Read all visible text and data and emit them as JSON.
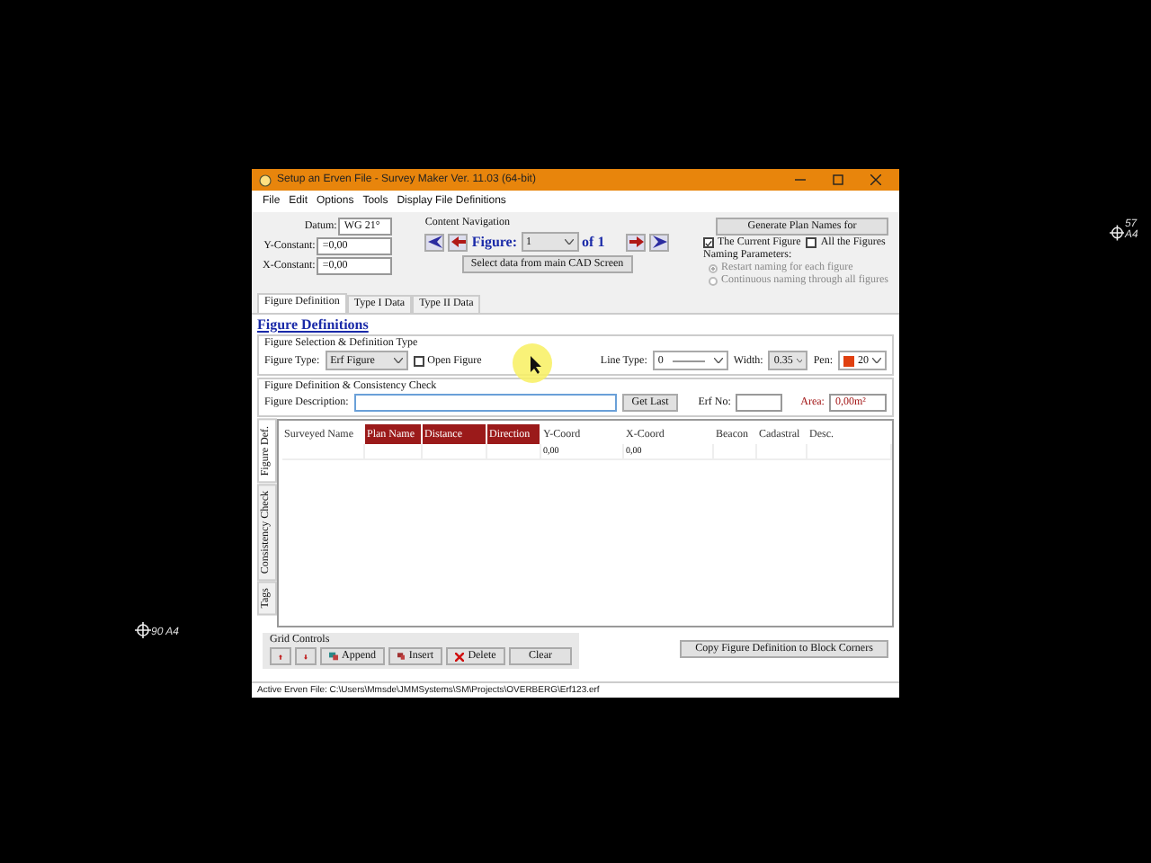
{
  "window": {
    "title": "Setup an Erven File - Survey Maker Ver. 11.03 (64-bit)"
  },
  "menu": [
    "File",
    "Edit",
    "Options",
    "Tools",
    "Display File Definitions"
  ],
  "coordinates": [
    {
      "label": "Datum:",
      "value": "WG 21°"
    },
    {
      "label": "Y-Constant:",
      "value": "=0,00"
    },
    {
      "label": "X-Constant:",
      "value": "=0,00"
    }
  ],
  "navigation": {
    "title": "Content Navigation",
    "figure_label": "Figure:",
    "figure_value": "1",
    "of_label": "of 1",
    "select_button": "Select data from main CAD Screen"
  },
  "naming": {
    "generate_button": "Generate Plan Names for",
    "options": [
      {
        "label": "The Current Figure",
        "checked": true
      },
      {
        "label": "All the Figures",
        "checked": false
      }
    ],
    "parameters_title": "Naming Parameters:",
    "radios": [
      {
        "label": "Restart naming for each figure",
        "selected": true,
        "disabled": true
      },
      {
        "label": "Continuous naming through all figures",
        "selected": false,
        "disabled": true
      }
    ]
  },
  "tabs": [
    {
      "label": "Figure Definition",
      "selected": true
    },
    {
      "label": "Type I Data",
      "selected": false
    },
    {
      "label": "Type II Data",
      "selected": false
    }
  ],
  "heading": "Figure Definitions",
  "selection_group": {
    "title": "Figure Selection & Definition Type",
    "figure_type_label": "Figure Type:",
    "figure_type_value": "Erf Figure",
    "open_figure": {
      "label": "Open Figure",
      "checked": false
    },
    "line_type_label": "Line Type:",
    "line_type_value": "0",
    "width_label": "Width:",
    "width_value": "0.35",
    "pen_label": "Pen:",
    "pen_value": "20"
  },
  "definition_group": {
    "title": "Figure Definition & Consistency Check",
    "description_label": "Figure Description:",
    "get_last_button": "Get Last",
    "erf_label": "Erf No:",
    "area_label": "Area:",
    "area_value": "0,00m²"
  },
  "side_tabs": [
    {
      "label": "Figure Def.",
      "selected": true
    },
    {
      "label": "Consistency Check",
      "selected": false
    },
    {
      "label": "Tags",
      "selected": false
    }
  ],
  "grid": {
    "columns": [
      {
        "label": "Surveyed Name",
        "highlighted": false
      },
      {
        "label": "Plan Name",
        "highlighted": true
      },
      {
        "label": "Distance",
        "highlighted": true
      },
      {
        "label": "Direction",
        "highlighted": true
      },
      {
        "label": "Y-Coord",
        "highlighted": false
      },
      {
        "label": "X-Coord",
        "highlighted": false
      },
      {
        "label": "Beacon",
        "highlighted": false
      },
      {
        "label": "Cadastral",
        "highlighted": false
      },
      {
        "label": "Desc.",
        "highlighted": false
      }
    ],
    "rows": [
      [
        null,
        null,
        null,
        null,
        "0,00",
        "0,00",
        null,
        null,
        null
      ]
    ]
  },
  "grid_controls": {
    "title": "Grid Controls",
    "buttons": [
      {
        "kind": "up"
      },
      {
        "kind": "down"
      },
      {
        "kind": "append",
        "label": "Append"
      },
      {
        "kind": "insert",
        "label": "Insert"
      },
      {
        "kind": "delete",
        "label": "Delete"
      },
      {
        "kind": "clear",
        "label": "Clear"
      }
    ]
  },
  "copy_button": "Copy Figure Definition to Block Corners",
  "status_bar": "Active Erven File: C:\\Users\\Mmsde\\JMMSystems\\SM\\Projects\\OVERBERG\\Erf123.erf",
  "canvas_markers": [
    {
      "label": "57 A4"
    },
    {
      "label": "90 A4"
    }
  ]
}
